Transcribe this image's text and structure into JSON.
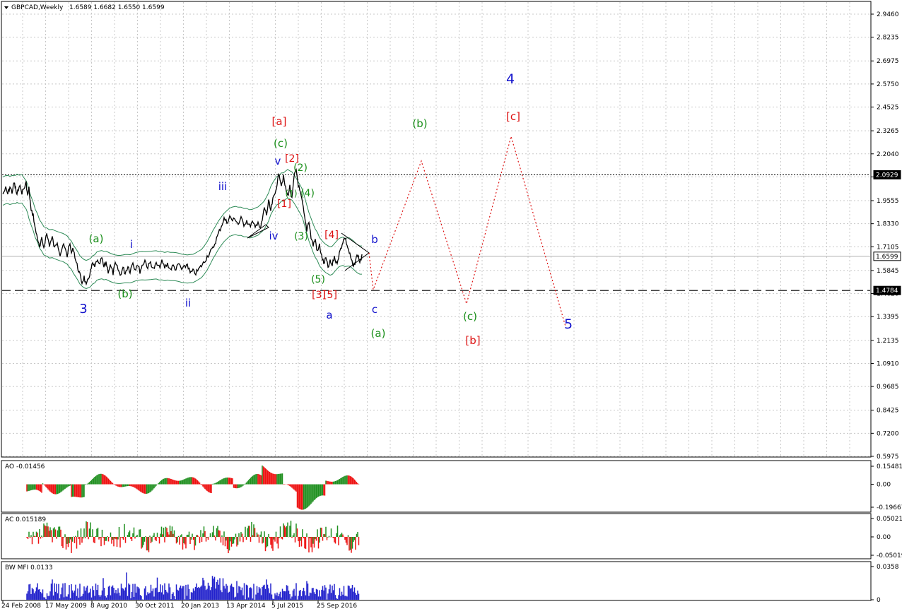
{
  "header": {
    "symbol": "GBPCAD,Weekly",
    "ohlc": "1.6589 1.6682 1.6550 1.6599",
    "menu_icon": "triangle-down-icon"
  },
  "chart_data": [
    {
      "type": "line",
      "name": "price",
      "title": "GBPCAD,Weekly 1.6589 1.6682 1.6550 1.6599",
      "yticks": [
        "2.9460",
        "2.8235",
        "2.6975",
        "2.5750",
        "2.4525",
        "2.3265",
        "2.2040",
        "2.0815",
        "1.9555",
        "1.8330",
        "1.7105",
        "1.5845",
        "1.4620",
        "1.3395",
        "1.2135",
        "1.0910",
        "0.9685",
        "0.8425",
        "0.7200",
        "0.5975"
      ],
      "ylim": [
        0.5975,
        2.946
      ],
      "xticks": [
        "24 Feb 2008",
        "17 May 2009",
        "8 Aug 2010",
        "30 Oct 2011",
        "20 Jan 2013",
        "13 Apr 2014",
        "5 Jul 2015",
        "25 Sep 2016"
      ],
      "price_tags": [
        {
          "value": "2.0929",
          "style": "dotted"
        },
        {
          "value": "1.6599",
          "style": "solid"
        },
        {
          "value": "1.4784",
          "style": "dashed"
        }
      ],
      "price_path": [
        [
          0,
          1.99
        ],
        [
          4,
          2.02
        ],
        [
          7,
          1.99
        ],
        [
          10,
          2.03
        ],
        [
          13,
          2.0
        ],
        [
          16,
          2.05
        ],
        [
          18,
          2.02
        ],
        [
          20,
          1.98
        ],
        [
          23,
          2.04
        ],
        [
          27,
          2.0
        ],
        [
          30,
          2.02
        ],
        [
          33,
          2.05
        ],
        [
          35,
          1.98
        ],
        [
          37,
          2.02
        ],
        [
          40,
          1.9
        ],
        [
          43,
          1.88
        ],
        [
          46,
          1.8
        ],
        [
          49,
          1.76
        ],
        [
          52,
          1.7
        ],
        [
          55,
          1.75
        ],
        [
          58,
          1.71
        ],
        [
          62,
          1.78
        ],
        [
          66,
          1.72
        ],
        [
          70,
          1.76
        ],
        [
          73,
          1.7
        ],
        [
          77,
          1.74
        ],
        [
          81,
          1.67
        ],
        [
          85,
          1.72
        ],
        [
          88,
          1.7
        ],
        [
          91,
          1.66
        ],
        [
          94,
          1.73
        ],
        [
          97,
          1.68
        ],
        [
          100,
          1.7
        ],
        [
          103,
          1.64
        ],
        [
          106,
          1.6
        ],
        [
          109,
          1.56
        ],
        [
          112,
          1.52
        ],
        [
          115,
          1.55
        ],
        [
          118,
          1.5
        ],
        [
          121,
          1.54
        ],
        [
          124,
          1.58
        ],
        [
          127,
          1.62
        ],
        [
          130,
          1.6
        ],
        [
          133,
          1.64
        ],
        [
          136,
          1.61
        ],
        [
          140,
          1.65
        ],
        [
          143,
          1.6
        ],
        [
          146,
          1.63
        ],
        [
          149,
          1.58
        ],
        [
          152,
          1.61
        ],
        [
          156,
          1.57
        ],
        [
          159,
          1.62
        ],
        [
          163,
          1.59
        ],
        [
          166,
          1.56
        ],
        [
          170,
          1.6
        ],
        [
          173,
          1.57
        ],
        [
          177,
          1.61
        ],
        [
          180,
          1.58
        ],
        [
          184,
          1.63
        ],
        [
          187,
          1.59
        ],
        [
          190,
          1.62
        ],
        [
          194,
          1.58
        ],
        [
          197,
          1.61
        ],
        [
          201,
          1.64
        ],
        [
          205,
          1.6
        ],
        [
          209,
          1.63
        ],
        [
          213,
          1.59
        ],
        [
          217,
          1.62
        ],
        [
          221,
          1.6
        ],
        [
          225,
          1.63
        ],
        [
          229,
          1.6
        ],
        [
          233,
          1.62
        ],
        [
          237,
          1.59
        ],
        [
          241,
          1.61
        ],
        [
          245,
          1.59
        ],
        [
          249,
          1.62
        ],
        [
          253,
          1.59
        ],
        [
          257,
          1.6
        ],
        [
          261,
          1.62
        ],
        [
          265,
          1.57
        ],
        [
          269,
          1.58
        ],
        [
          273,
          1.57
        ],
        [
          277,
          1.59
        ],
        [
          281,
          1.61
        ],
        [
          285,
          1.63
        ],
        [
          289,
          1.66
        ],
        [
          293,
          1.68
        ],
        [
          297,
          1.7
        ],
        [
          301,
          1.74
        ],
        [
          305,
          1.78
        ],
        [
          309,
          1.82
        ],
        [
          313,
          1.86
        ],
        [
          317,
          1.84
        ],
        [
          321,
          1.87
        ],
        [
          325,
          1.85
        ],
        [
          329,
          1.86
        ],
        [
          333,
          1.83
        ],
        [
          337,
          1.86
        ],
        [
          341,
          1.83
        ],
        [
          345,
          1.85
        ],
        [
          349,
          1.82
        ],
        [
          353,
          1.84
        ],
        [
          357,
          1.81
        ],
        [
          361,
          1.85
        ],
        [
          364,
          1.8
        ],
        [
          367,
          1.85
        ],
        [
          370,
          1.92
        ],
        [
          373,
          1.88
        ],
        [
          376,
          1.95
        ],
        [
          379,
          1.9
        ],
        [
          382,
          1.96
        ],
        [
          385,
          1.99
        ],
        [
          388,
          2.05
        ],
        [
          391,
          2.1
        ],
        [
          394,
          2.04
        ],
        [
          397,
          2.08
        ],
        [
          400,
          2.02
        ],
        [
          403,
          1.98
        ],
        [
          406,
          2.03
        ],
        [
          409,
          1.96
        ],
        [
          412,
          2.08
        ],
        [
          415,
          2.12
        ],
        [
          418,
          2.04
        ],
        [
          421,
          1.99
        ],
        [
          424,
          1.94
        ],
        [
          427,
          1.86
        ],
        [
          430,
          1.8
        ],
        [
          433,
          1.85
        ],
        [
          436,
          1.76
        ],
        [
          439,
          1.72
        ],
        [
          442,
          1.75
        ],
        [
          445,
          1.68
        ],
        [
          448,
          1.72
        ],
        [
          451,
          1.66
        ],
        [
          454,
          1.62
        ],
        [
          457,
          1.65
        ],
        [
          460,
          1.6
        ],
        [
          463,
          1.63
        ],
        [
          466,
          1.61
        ],
        [
          469,
          1.66
        ],
        [
          472,
          1.62
        ],
        [
          475,
          1.66
        ],
        [
          478,
          1.7
        ],
        [
          481,
          1.74
        ],
        [
          484,
          1.76
        ],
        [
          487,
          1.72
        ],
        [
          490,
          1.68
        ],
        [
          493,
          1.64
        ],
        [
          496,
          1.6
        ],
        [
          499,
          1.64
        ],
        [
          502,
          1.67
        ],
        [
          505,
          1.63
        ],
        [
          508,
          1.66
        ]
      ]
    },
    {
      "type": "bar",
      "name": "AO",
      "title": "AO -0.01456",
      "yticks": [
        "0.15481",
        "0.00",
        "-0.19667"
      ],
      "ylim": [
        -0.19667,
        0.15481
      ]
    },
    {
      "type": "bar",
      "name": "AC",
      "title": "AC 0.015189",
      "yticks": [
        "0.050211",
        "0.00",
        "-0.05019"
      ],
      "ylim": [
        -0.05019,
        0.050211
      ]
    },
    {
      "type": "bar",
      "name": "BW MFI",
      "title": "BW MFI 0.0133",
      "yticks": [
        "0.0358",
        "0"
      ],
      "ylim": [
        0,
        0.0358
      ]
    }
  ],
  "wave_labels": {
    "blue": [
      "3",
      "i",
      "ii",
      "iii",
      "iv",
      "v",
      "a",
      "b",
      "c",
      "4",
      "5"
    ],
    "green": [
      "(a)",
      "(b)",
      "(c)",
      "(1)",
      "(2)",
      "(3)",
      "(4)",
      "(5)",
      "(a)",
      "(b)",
      "(c)"
    ],
    "red": [
      "[a]",
      "[1]",
      "[2]",
      "[3]",
      "[4]",
      "[5]",
      "[b]",
      "[c]"
    ]
  },
  "colors": {
    "blue": "#1111cc",
    "green": "#1a8f1a",
    "red": "#dd1111",
    "up_bar": "#1f8f1f",
    "down_bar": "#ee1111",
    "mfi_bar": "#2222cc",
    "band": "#2e8b57"
  }
}
